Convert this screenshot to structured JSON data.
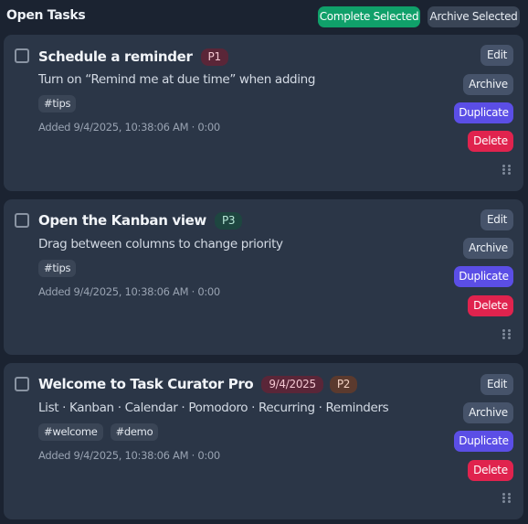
{
  "header": {
    "title": "Open Tasks",
    "complete_selected_label": "Complete Selected",
    "archive_selected_label": "Archive Selected"
  },
  "colors": {
    "background": "#1b2331",
    "card": "#2b3647",
    "complete_button": "#10a06a",
    "duplicate_button": "#5b4ee6",
    "delete_button": "#e0234e"
  },
  "tasks": [
    {
      "title": "Schedule a reminder",
      "priority": "P1",
      "date": "",
      "description": "Turn on “Remind me at due time” when adding",
      "tags": [
        "#tips"
      ],
      "meta": "Added 9/4/2025, 10:38:06 AM · 0:00"
    },
    {
      "title": "Open the Kanban view",
      "priority": "P3",
      "date": "",
      "description": "Drag between columns to change priority",
      "tags": [
        "#tips"
      ],
      "meta": "Added 9/4/2025, 10:38:06 AM · 0:00"
    },
    {
      "title": "Welcome to Task Curator Pro",
      "priority": "P2",
      "date": "9/4/2025",
      "description": "List · Kanban · Calendar · Pomodoro · Recurring · Reminders",
      "tags": [
        "#welcome",
        "#demo"
      ],
      "meta": "Added 9/4/2025, 10:38:06 AM · 0:00"
    }
  ],
  "actions": {
    "edit_label": "Edit",
    "archive_label": "Archive",
    "duplicate_label": "Duplicate",
    "delete_label": "Delete",
    "drag_handle_icon": "drag-handle-icon",
    "checkbox_icon": "checkbox-icon"
  }
}
